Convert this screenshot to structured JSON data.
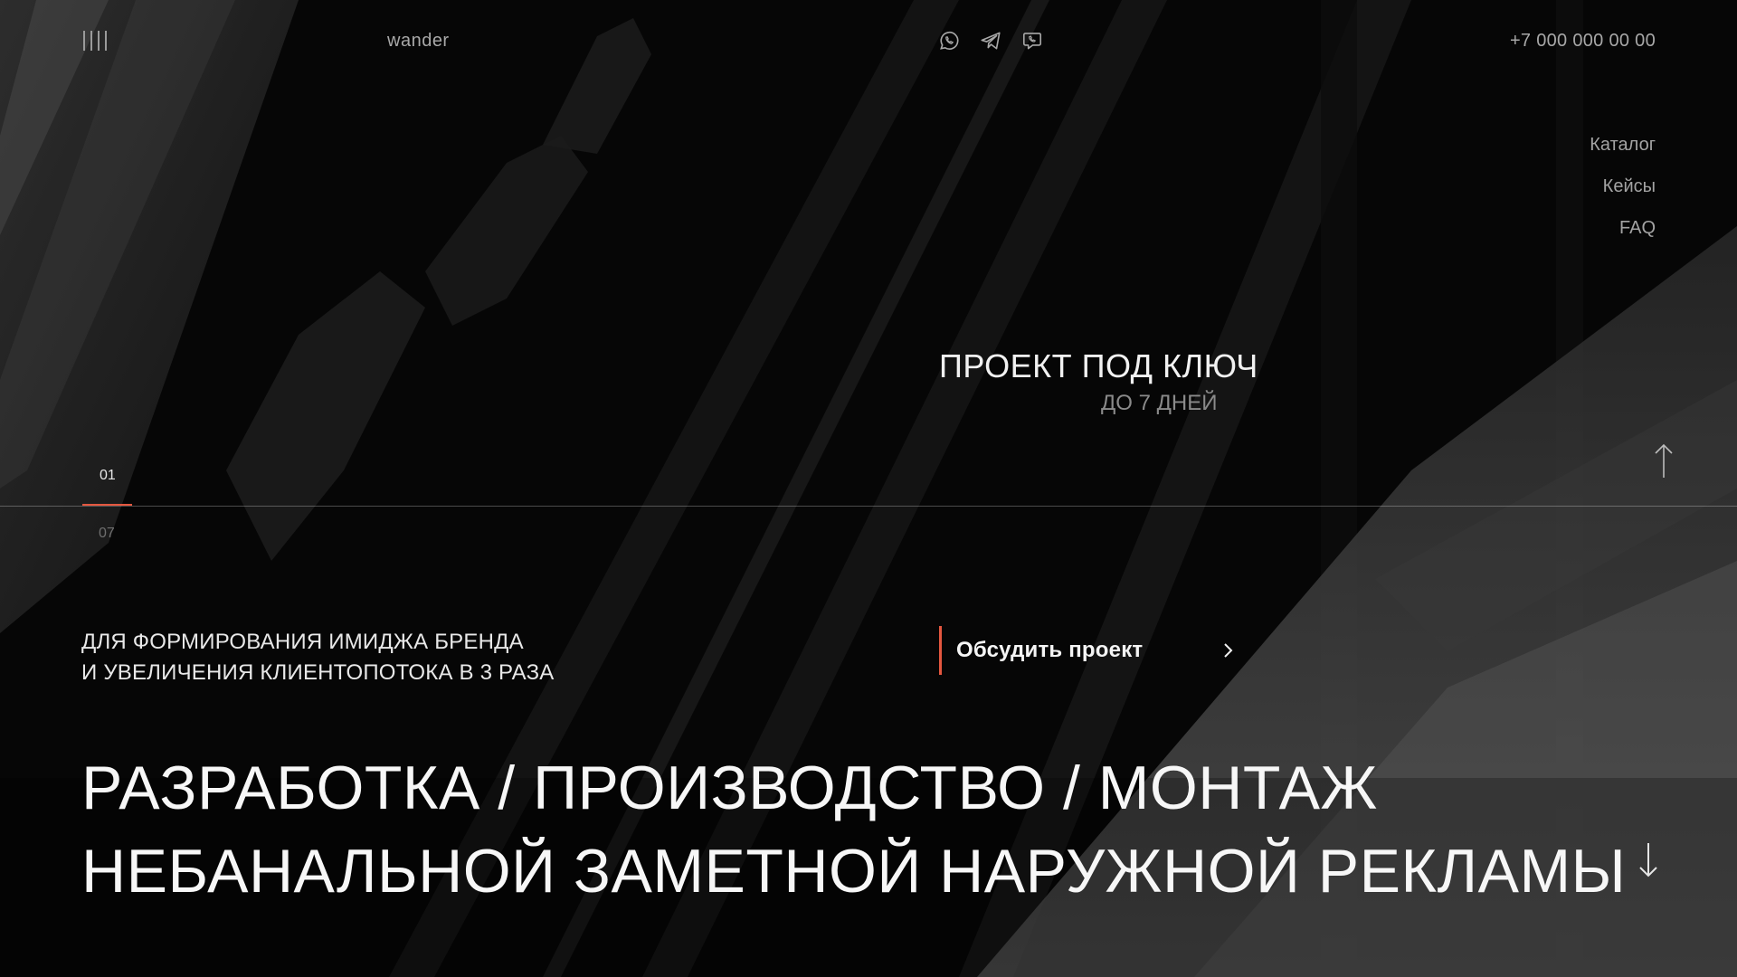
{
  "header": {
    "logo": "wander",
    "phone": "+7 000 000 00 00",
    "messengers": [
      "whatsapp-icon",
      "telegram-icon",
      "viber-icon"
    ]
  },
  "nav": {
    "items": [
      {
        "label": "Каталог"
      },
      {
        "label": "Кейсы"
      },
      {
        "label": "FAQ"
      }
    ]
  },
  "promo": {
    "title": "ПРОЕКТ ПОД КЛЮЧ",
    "subtitle": "ДО 7 ДНЕЙ"
  },
  "slider": {
    "current": "01",
    "total": "07"
  },
  "tagline": {
    "line1": "ДЛЯ ФОРМИРОВАНИЯ ИМИДЖА БРЕНДА",
    "line2": "И УВЕЛИЧЕНИЯ КЛИЕНТОПОТОКА В 3 РАЗА"
  },
  "cta": {
    "label": "Обсудить проект"
  },
  "headline": {
    "line1": "РАЗРАБОТКА / ПРОИЗВОДСТВО / МОНТАЖ",
    "line2": "НЕБАНАЛЬНОЙ ЗАМЕТНОЙ НАРУЖНОЙ РЕКЛАМЫ"
  },
  "colors": {
    "accent": "#e4573f",
    "background": "#050505",
    "text": "#f5f5f5",
    "muted": "#a3a3a3"
  }
}
